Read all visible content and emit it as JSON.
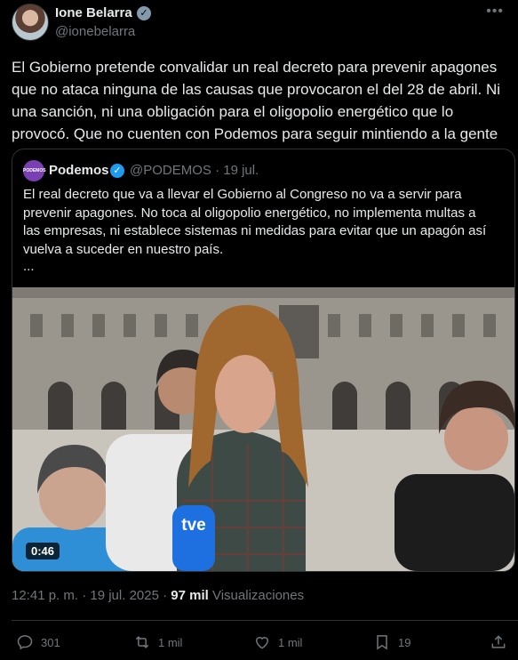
{
  "author": {
    "name": "Ione Belarra",
    "handle": "@ionebelarra",
    "verified_color": "#829aab"
  },
  "tweet": {
    "lines": [
      "El Gobierno pretende convalidar un real decreto para prevenir apagones",
      "que no ataca ninguna de las causas que provocaron el del 28 de abril. Ni",
      "una sanción, ni una obligación para el oligopolio energético que lo",
      "provocó. Que no cuenten con Podemos para seguir mintiendo a la gente"
    ]
  },
  "quote": {
    "name": "Podemos",
    "handle_date": "@PODEMOS · 19 jul.",
    "verified_color": "#1d9bf0",
    "lines": [
      "El real decreto que va a llevar el Gobierno al Congreso no va a servir para",
      "prevenir apagones. No toca al oligopolio energético, no implementa multas a",
      "las empresas, ni establece sistemas ni medidas para evitar que un apagón así",
      "vuelva a suceder en nuestro país."
    ],
    "ellipsis": "...",
    "video": {
      "duration": "0:46",
      "mic_label": "tve"
    }
  },
  "meta": {
    "timestamp": "12:41 p. m. · 19 jul. 2025 ·",
    "views_count": "97 mil",
    "views_label": "Visualizaciones"
  },
  "actions": {
    "replies": "301",
    "reposts": "1 mil",
    "likes": "1 mil",
    "bookmarks": "19"
  },
  "colors": {
    "background": "#000000",
    "text": "#e7e9ea",
    "secondary": "#71767b",
    "border": "#2f3336"
  }
}
